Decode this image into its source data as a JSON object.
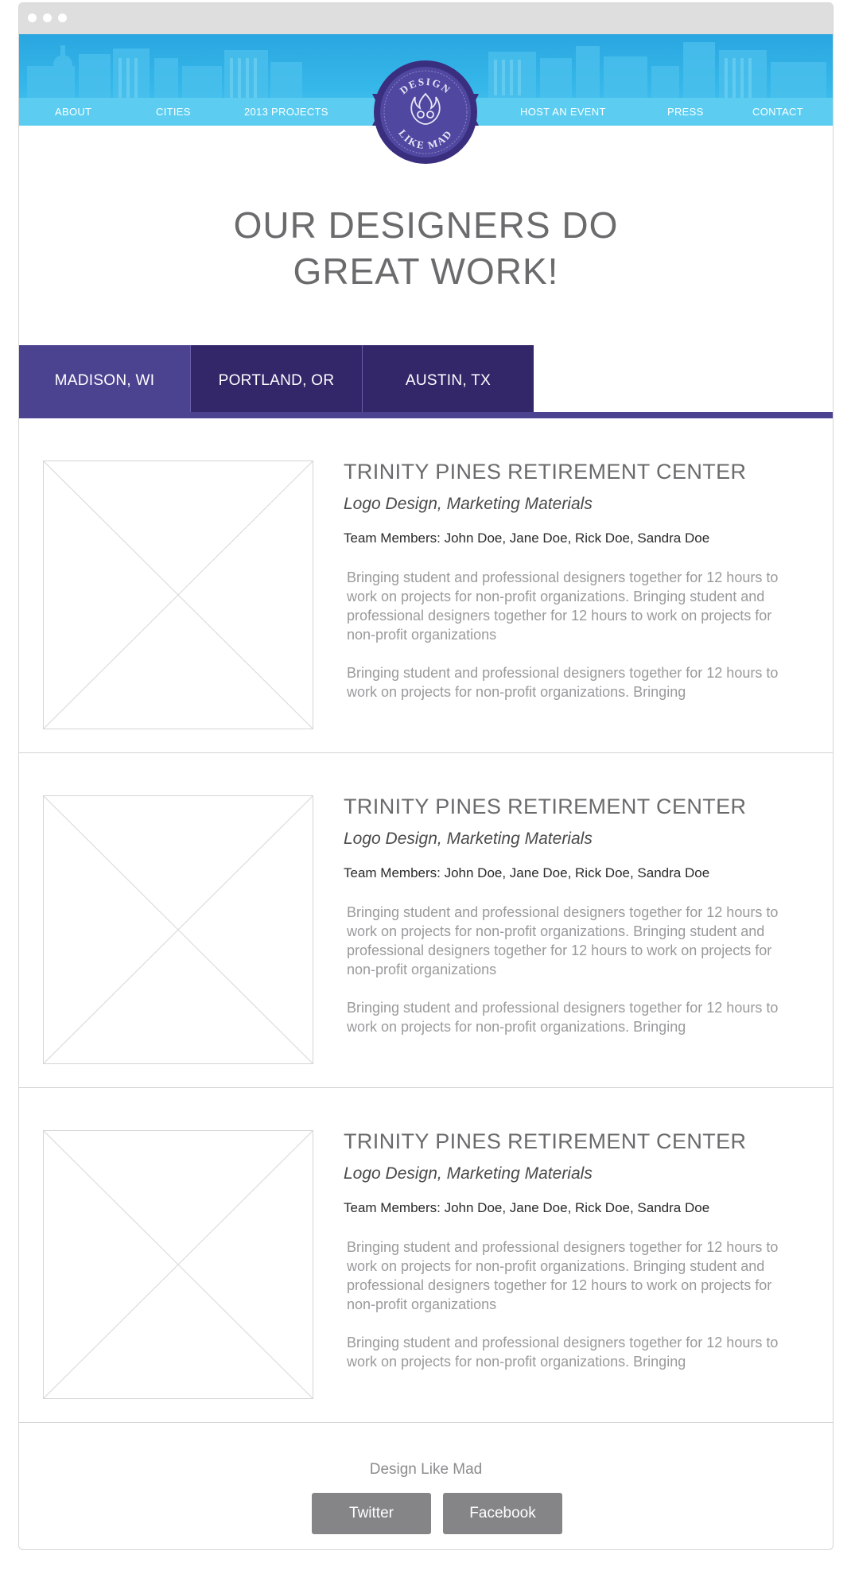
{
  "nav": {
    "left": [
      "ABOUT",
      "CITIES",
      "2013 PROJECTS"
    ],
    "right": [
      "HOST AN EVENT",
      "PRESS",
      "CONTACT"
    ]
  },
  "logo": {
    "top_text": "DESIGN",
    "bottom_text": "LIKE MAD",
    "icon": "flame-face-icon"
  },
  "hero": {
    "line1": "OUR DESIGNERS DO",
    "line2": "GREAT WORK!"
  },
  "tabs": [
    "MADISON, WI",
    "PORTLAND, OR",
    "AUSTIN, TX"
  ],
  "projects": [
    {
      "title": "TRINITY PINES RETIREMENT CENTER",
      "type": "Logo Design, Marketing Materials",
      "team": "Team Members: John Doe, Jane Doe, Rick Doe, Sandra Doe",
      "desc1": "Bringing student and professional designers together for 12 hours to work on projects for non-profit organizations. Bringing student and professional designers together for 12 hours to work on projects for non-profit organizations",
      "desc2": "Bringing student and professional designers together for 12 hours to work on projects for non-profit organizations. Bringing"
    },
    {
      "title": "TRINITY PINES RETIREMENT CENTER",
      "type": "Logo Design, Marketing Materials",
      "team": "Team Members: John Doe, Jane Doe, Rick Doe, Sandra Doe",
      "desc1": "Bringing student and professional designers together for 12 hours to work on projects for non-profit organizations. Bringing student and professional designers together for 12 hours to work on projects for non-profit organizations",
      "desc2": "Bringing student and professional designers together for 12 hours to work on projects for non-profit organizations. Bringing"
    },
    {
      "title": "TRINITY PINES RETIREMENT CENTER",
      "type": "Logo Design, Marketing Materials",
      "team": "Team Members: John Doe, Jane Doe, Rick Doe, Sandra Doe",
      "desc1": "Bringing student and professional designers together for 12 hours to work on projects for non-profit organizations. Bringing student and professional designers together for 12 hours to work on projects for non-profit organizations",
      "desc2": "Bringing student and professional designers together for 12 hours to work on projects for non-profit organizations. Bringing"
    }
  ],
  "footer": {
    "name": "Design Like Mad",
    "twitter": "Twitter",
    "facebook": "Facebook"
  },
  "colors": {
    "header_blue": "#2aa6e0",
    "nav_blue": "#5ccdf0",
    "purple_active": "#4b4390",
    "purple_dark": "#33276a",
    "button_gray": "#858587"
  }
}
